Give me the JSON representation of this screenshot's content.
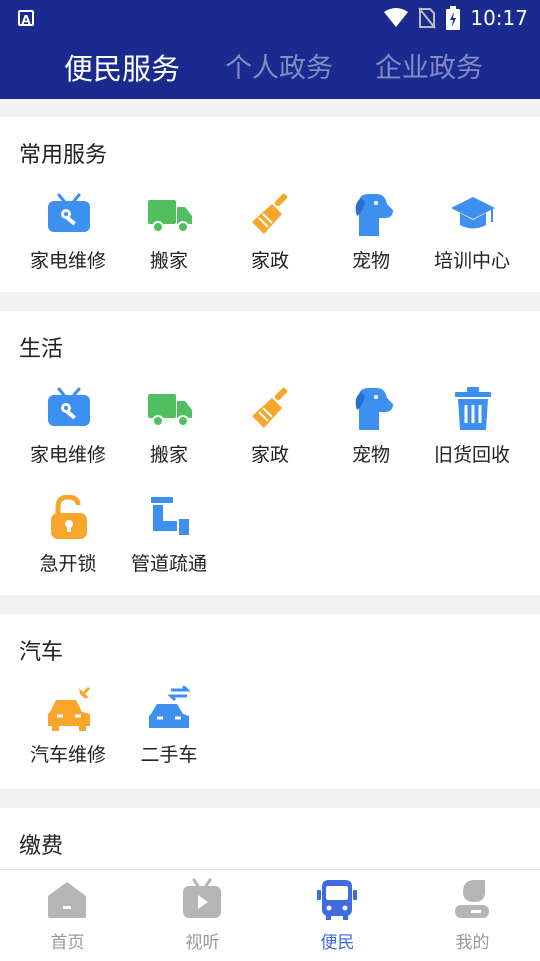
{
  "status_bar": {
    "time": "10:17",
    "app_icon": "A"
  },
  "tabs": [
    {
      "label": "便民服务",
      "active": true
    },
    {
      "label": "个人政务",
      "active": false
    },
    {
      "label": "企业政务",
      "active": false
    }
  ],
  "sections": {
    "common": {
      "title": "常用服务",
      "items": [
        {
          "label": "家电维修",
          "icon": "tv-repair-icon"
        },
        {
          "label": "搬家",
          "icon": "truck-icon"
        },
        {
          "label": "家政",
          "icon": "broom-icon"
        },
        {
          "label": "宠物",
          "icon": "dog-icon"
        },
        {
          "label": "培训中心",
          "icon": "graduation-cap-icon"
        }
      ]
    },
    "life": {
      "title": "生活",
      "items": [
        {
          "label": "家电维修",
          "icon": "tv-repair-icon"
        },
        {
          "label": "搬家",
          "icon": "truck-icon"
        },
        {
          "label": "家政",
          "icon": "broom-icon"
        },
        {
          "label": "宠物",
          "icon": "dog-icon"
        },
        {
          "label": "旧货回收",
          "icon": "trash-can-icon"
        },
        {
          "label": "急开锁",
          "icon": "unlock-icon"
        },
        {
          "label": "管道疏通",
          "icon": "pipe-icon"
        }
      ]
    },
    "car": {
      "title": "汽车",
      "items": [
        {
          "label": "汽车维修",
          "icon": "car-repair-icon"
        },
        {
          "label": "二手车",
          "icon": "car-exchange-icon"
        }
      ]
    },
    "fees": {
      "title": "缴费"
    }
  },
  "bottom_nav": [
    {
      "label": "首页",
      "icon": "home-icon",
      "active": false
    },
    {
      "label": "视听",
      "icon": "tv-play-icon",
      "active": false
    },
    {
      "label": "便民",
      "icon": "bus-icon",
      "active": true
    },
    {
      "label": "我的",
      "icon": "user-icon",
      "active": false
    }
  ],
  "colors": {
    "header": "#1b2a8f",
    "active_nav": "#3f6be0",
    "blue_icon": "#3d8ff0",
    "green_icon": "#4fbf5f",
    "orange_icon": "#f7a52b"
  }
}
